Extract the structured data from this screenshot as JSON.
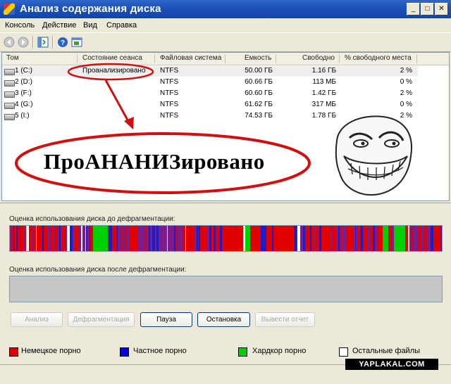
{
  "window": {
    "title": "Анализ содержания диска",
    "controls": [
      "_",
      "□",
      "✕"
    ]
  },
  "menu": [
    "Консоль",
    "Действие",
    "Вид",
    "Справка"
  ],
  "toolbar": {
    "icons": [
      "back-icon",
      "forward-icon",
      "show-hide-tree-icon",
      "help-icon",
      "properties-icon"
    ]
  },
  "table": {
    "columns": [
      "Том",
      "Состояние сеанса",
      "Файловая система",
      "Емкость",
      "Свободно",
      "% свободного места"
    ],
    "rows": [
      {
        "volume": "1 (C:)",
        "status": "Проанализировано",
        "fs": "NTFS",
        "capacity": "50.00 ГБ",
        "free": "1.16 ГБ",
        "percent": "2 %"
      },
      {
        "volume": "2 (D:)",
        "status": "",
        "fs": "NTFS",
        "capacity": "60.66 ГБ",
        "free": "113 МБ",
        "percent": "0 %"
      },
      {
        "volume": "3 (F:)",
        "status": "",
        "fs": "NTFS",
        "capacity": "60.60 ГБ",
        "free": "1.42 ГБ",
        "percent": "2 %"
      },
      {
        "volume": "4 (G:)",
        "status": "",
        "fs": "NTFS",
        "capacity": "61.62 ГБ",
        "free": "317 МБ",
        "percent": "0 %"
      },
      {
        "volume": "5 (I:)",
        "status": "",
        "fs": "NTFS",
        "capacity": "74.53 ГБ",
        "free": "1.78 ГБ",
        "percent": "2 %"
      }
    ]
  },
  "annotation": {
    "text": "ПроАНАНИЗировано"
  },
  "analysis": {
    "before_label": "Оценка использования диска до дефрагментации:",
    "after_label": "Оценка использования диска после дефрагментации:"
  },
  "buttons": {
    "analyze": "Анализ",
    "defrag": "Дефрагментация",
    "pause": "Пауза",
    "stop": "Остановка",
    "report": "Вывести отчет"
  },
  "legend": [
    {
      "label": "Немецкое порно",
      "color": "#e00000"
    },
    {
      "label": "Частное порно",
      "color": "#0000e0"
    },
    {
      "label": "Хардкор порно",
      "color": "#00d000"
    },
    {
      "label": "Остальные файлы",
      "color": "#ffffff"
    }
  ],
  "colors": {
    "red": "#e00000",
    "blue": "#1c1cc8",
    "purple": "#7a1e8c",
    "green": "#00d000",
    "white": "#ffffff"
  },
  "watermark": "YAPLAKAL.COM"
}
